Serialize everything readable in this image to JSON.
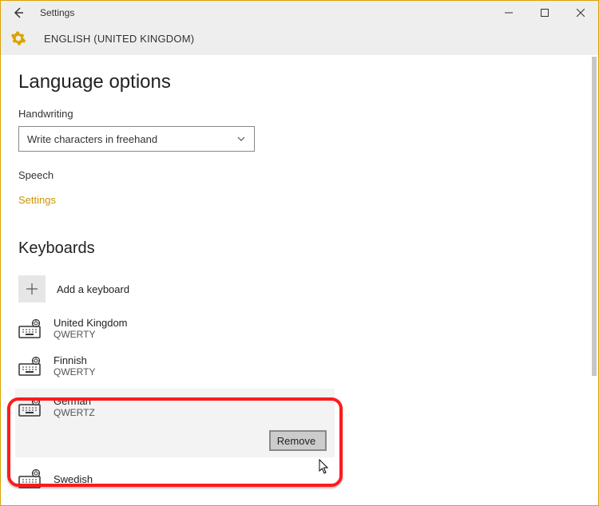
{
  "window": {
    "title": "Settings",
    "header": "ENGLISH (UNITED KINGDOM)"
  },
  "page": {
    "heading": "Language options",
    "handwriting_label": "Handwriting",
    "handwriting_value": "Write characters in freehand",
    "speech_label": "Speech",
    "speech_link": "Settings",
    "keyboards_heading": "Keyboards",
    "add_keyboard": "Add a keyboard",
    "remove_label": "Remove"
  },
  "keyboards": [
    {
      "name": "United Kingdom",
      "layout": "QWERTY"
    },
    {
      "name": "Finnish",
      "layout": "QWERTY"
    },
    {
      "name": "German",
      "layout": "QWERTZ"
    },
    {
      "name": "Swedish",
      "layout": ""
    }
  ]
}
